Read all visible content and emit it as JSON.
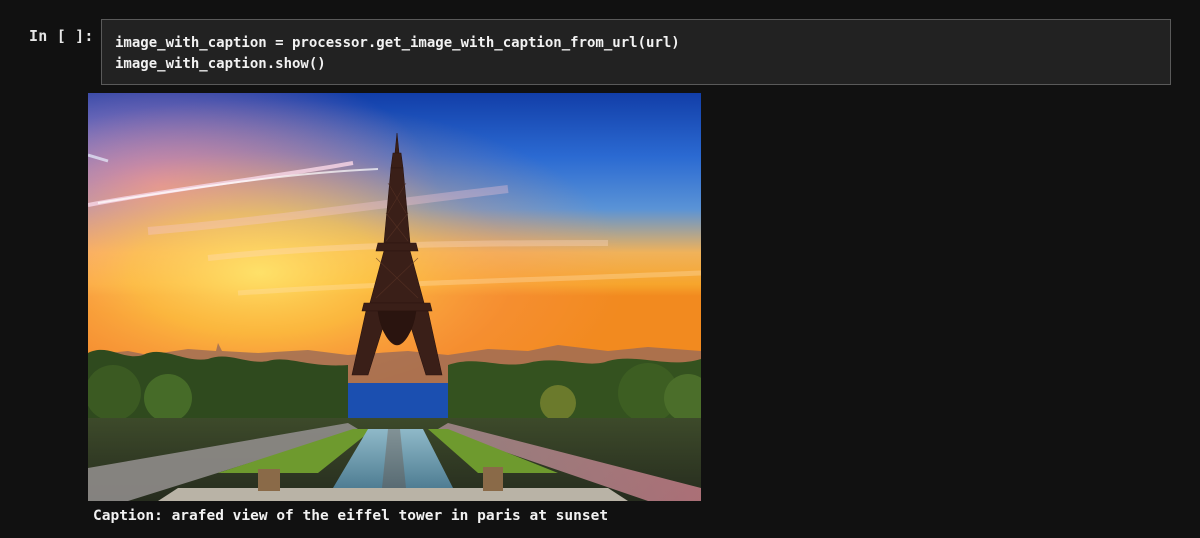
{
  "cell": {
    "prompt": "In [ ]:",
    "code_lines": [
      "image_with_caption = processor.get_image_with_caption_from_url(url)",
      "image_with_caption.show()"
    ]
  },
  "output": {
    "image_subject": "Eiffel Tower at sunset viewed from the Trocadéro fountains",
    "caption": "Caption: arafed view of the eiffel tower in paris at sunset"
  },
  "colors": {
    "page_background": "#111111",
    "cell_background": "#222222",
    "cell_border": "#5a5a5a",
    "text": "#f2f2f2"
  }
}
